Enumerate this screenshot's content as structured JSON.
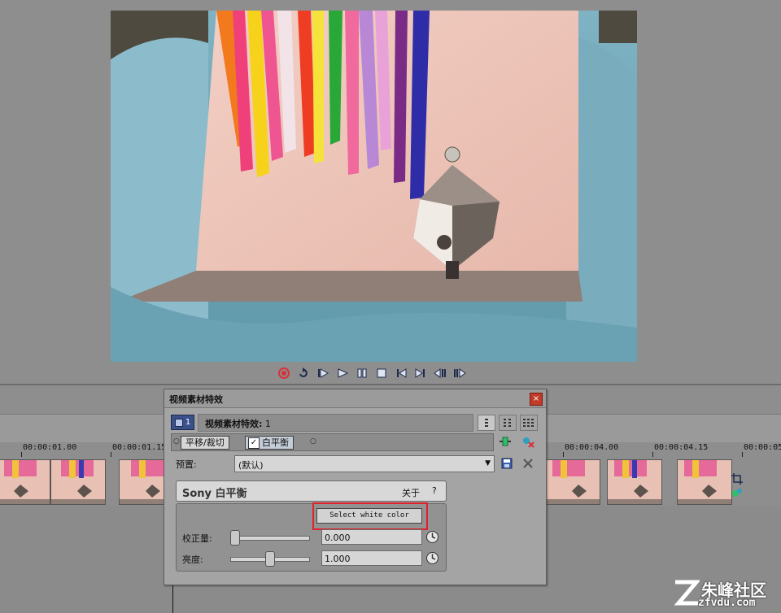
{
  "dialog": {
    "title": "视频素材特效",
    "close_glyph": "×",
    "clip_badge_number": "1",
    "chain_label": "视频素材特效:",
    "chain_index": "1",
    "plugins": [
      "平移/裁切",
      "白平衡"
    ],
    "preset_label": "预置:",
    "preset_value": "(默认)"
  },
  "plugin_panel": {
    "name": "Sony 白平衡",
    "about_label": "关于",
    "help_label": "?",
    "select_white_button": "Select white color",
    "params": [
      {
        "label": "校正量:",
        "value": "0.000",
        "slider_fraction": 0.0
      },
      {
        "label": "亮度:",
        "value": "1.000",
        "slider_fraction": 0.5
      }
    ]
  },
  "timeline": {
    "ticks": [
      "00:00:01.00",
      "00:00:01.15",
      "00:00:04.00",
      "00:00:04.15",
      "00:00:05"
    ]
  },
  "watermark": {
    "text": "朱峰社区",
    "url": "zfvdu.com"
  },
  "colors": {
    "highlight": "#e0202a",
    "record": "#d9303a",
    "close": "#c23a2a",
    "badge": "#39508a"
  },
  "icons": {
    "transport": [
      "record-icon",
      "loop-icon",
      "play-from-start-icon",
      "play-icon",
      "pause-icon",
      "stop-icon",
      "prev-marker-icon",
      "next-marker-icon",
      "prev-frame-icon",
      "next-frame-icon"
    ]
  }
}
